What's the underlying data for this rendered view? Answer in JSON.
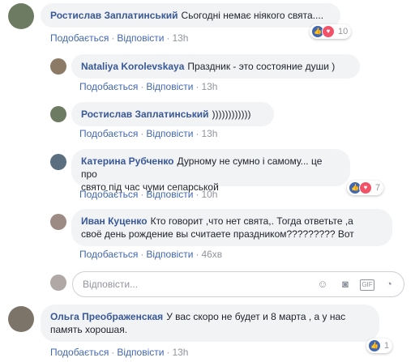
{
  "actions": {
    "like": "Подобається",
    "reply": "Відповісти"
  },
  "comments": [
    {
      "author": "Ростислав Заплатинський",
      "text": "Сьогодні немає ніякого свята....",
      "time": "13h",
      "reactions": "10"
    },
    {
      "author": "Nataliya Korolevskaya",
      "text": "Праздник - это состояние души )",
      "time": "13h"
    },
    {
      "author": "Ростислав Заплатинський",
      "text": "))))))))))))",
      "time": "13h"
    },
    {
      "author": "Катерина Рубченко",
      "text_line1": "Дурному не сумно і самому... це про",
      "text_line2": "свято під час чуми сепарськой",
      "time": "10h",
      "reactions": "7"
    },
    {
      "author": "Иван Куценко",
      "text_line1": "Кто говорит ,что нет свята,. Тогда ответьте ,а",
      "text_line2": "своё день рождение вы считаете праздником????????? Вот",
      "time": "46хв"
    },
    {
      "author": "Ольга Преображенская",
      "text_line1": "У вас скоро не будет и 8 марта , а у нас",
      "text_line2": "память хорошая.",
      "time": "13h",
      "reactions": "1"
    }
  ],
  "reply_box": {
    "placeholder": "Відповісти..."
  },
  "icons": {
    "emoji": "emoji-icon",
    "camera": "camera-icon",
    "gif": "gif-icon",
    "sticker": "sticker-icon"
  }
}
